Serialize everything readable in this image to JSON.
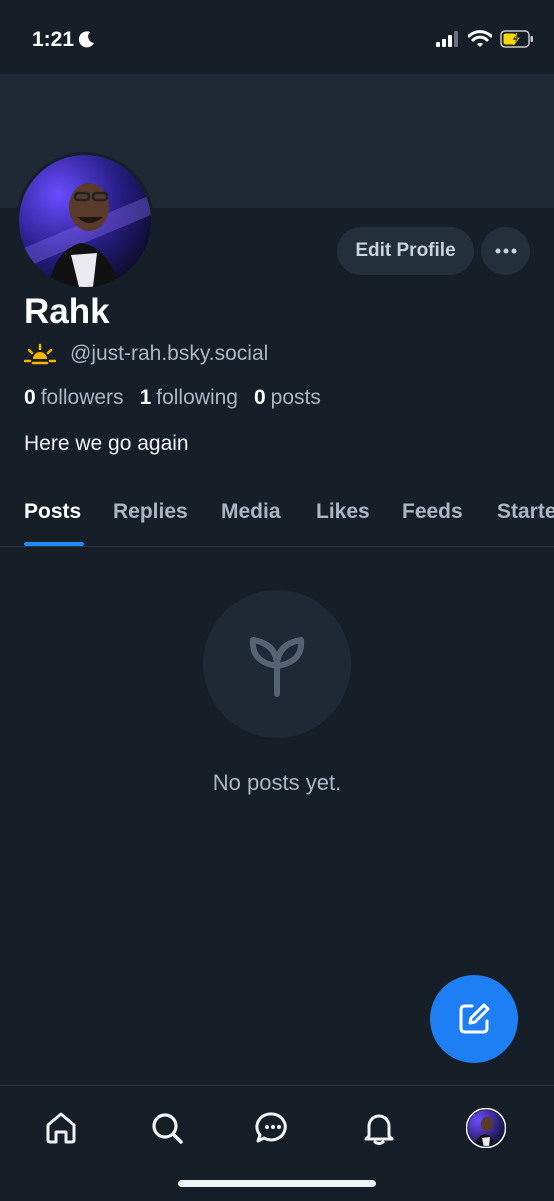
{
  "status_bar": {
    "time": "1:21"
  },
  "profile": {
    "name": "Rahk",
    "handle": "@just-rah.bsky.social",
    "followers_count": "0",
    "followers_label": "followers",
    "following_count": "1",
    "following_label": "following",
    "posts_count": "0",
    "posts_label": "posts",
    "bio": "Here we go again"
  },
  "actions": {
    "edit_profile": "Edit Profile"
  },
  "tabs": [
    {
      "label": "Posts",
      "active": true
    },
    {
      "label": "Replies"
    },
    {
      "label": "Media"
    },
    {
      "label": "Likes"
    },
    {
      "label": "Feeds"
    },
    {
      "label": "Starter Packs"
    }
  ],
  "empty_state": {
    "message": "No posts yet.",
    "icon": "sprout-icon"
  },
  "bottom_nav": [
    "home-icon",
    "search-icon",
    "chat-icon",
    "bell-icon",
    "avatar"
  ],
  "colors": {
    "background": "#161e27",
    "accent": "#208bfe",
    "fab": "#1e7ff5"
  }
}
